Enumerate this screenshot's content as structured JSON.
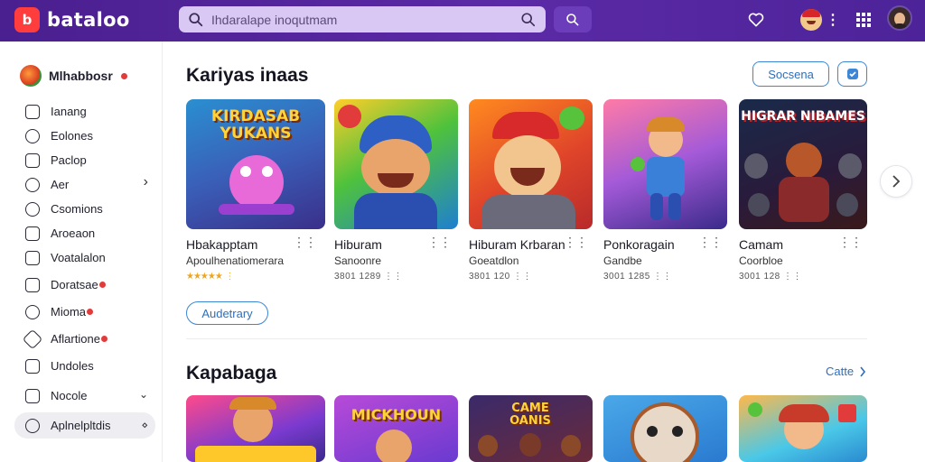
{
  "app": {
    "logo_mark": "b",
    "logo_text": "bataloo",
    "accent": "#5b2aa6"
  },
  "search": {
    "placeholder": "Ihdaralape inoqutmam"
  },
  "icons": {
    "search": "search-icon",
    "camera": "camera-search-icon",
    "heart": "heart-icon",
    "apps": "grid-icon",
    "more": "more-vertical-icon"
  },
  "sidebar": {
    "brand": "Mlhabbosr",
    "items": [
      {
        "label": "Ianang",
        "icon": "square-outline-icon"
      },
      {
        "label": "Eolones",
        "icon": "heart-outline-icon"
      },
      {
        "label": "Paclop",
        "icon": "square-check-icon"
      },
      {
        "label": "Aer",
        "icon": "target-icon",
        "chevron": "›"
      },
      {
        "label": "Csomions",
        "icon": "circle-icon"
      },
      {
        "label": "Aroeaon",
        "icon": "envelope-icon"
      },
      {
        "label": "Voatalalon",
        "icon": "square-icon"
      },
      {
        "label": "Doratsae",
        "icon": "checkbox-icon"
      },
      {
        "label": "Mioma",
        "icon": "chat-icon"
      },
      {
        "label": "Aflartione",
        "icon": "tag-icon"
      },
      {
        "label": "Undoles",
        "icon": "box-icon"
      },
      {
        "label": "Nocole",
        "icon": "shield-icon",
        "chevron": "⌄"
      },
      {
        "label": "Aplnelpltdis",
        "icon": "settings-icon",
        "chevron": "⋄"
      }
    ]
  },
  "section1": {
    "title": "Kariyas inaas",
    "action_label": "Socsena",
    "load_more": "Audetrary",
    "cards": [
      {
        "art": "KIRDASAB YUKANS",
        "title": "Hbakapptam",
        "subtitle": "Apoulhenatiomerara",
        "meta": "★★★★★   ⋮",
        "rating": 4.5
      },
      {
        "art": "",
        "title": "Hiburam",
        "subtitle": "Sanoonre",
        "meta": "3801 1289  ⋮⋮"
      },
      {
        "art": "",
        "title": "Hiburam Krbaran",
        "subtitle": "Goeatdlon",
        "meta": "3801 120  ⋮⋮"
      },
      {
        "art": "",
        "title": "Ponkoragain",
        "subtitle": "Gandbe",
        "meta": "3001 1285  ⋮⋮"
      },
      {
        "art": "HIGRAR NIBAMES",
        "title": "Camam",
        "subtitle": "Coorbloe",
        "meta": "3001 128  ⋮⋮"
      }
    ]
  },
  "section2": {
    "title": "Kapabaga",
    "see_all": "Catte",
    "cards": [
      {
        "art": ""
      },
      {
        "art": "MICKHOUN"
      },
      {
        "art": "CAME OANIS"
      },
      {
        "art": ""
      },
      {
        "art": ""
      }
    ]
  }
}
